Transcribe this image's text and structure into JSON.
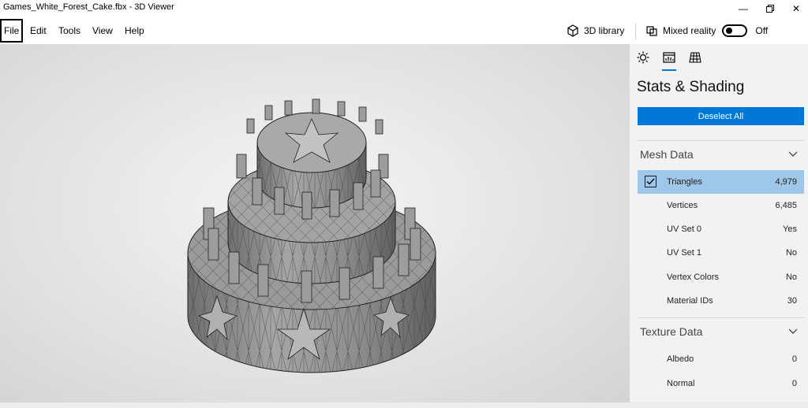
{
  "window": {
    "title": "Games_White_Forest_Cake.fbx - 3D Viewer"
  },
  "menu": [
    "File",
    "Edit",
    "Tools",
    "View",
    "Help"
  ],
  "toolbar": {
    "library_label": "3D library",
    "mixed_reality_label": "Mixed reality",
    "mixed_reality_state": "Off"
  },
  "panel": {
    "tabs": [
      "lighting-tab",
      "stats-shading-tab",
      "grid-tab"
    ],
    "title": "Stats & Shading",
    "deselect_label": "Deselect All",
    "mesh_section": "Mesh Data",
    "mesh_rows": [
      {
        "label": "Triangles",
        "value": "4,979"
      },
      {
        "label": "Vertices",
        "value": "6,485"
      },
      {
        "label": "UV Set 0",
        "value": "Yes"
      },
      {
        "label": "UV Set 1",
        "value": "No"
      },
      {
        "label": "Vertex Colors",
        "value": "No"
      },
      {
        "label": "Material IDs",
        "value": "30"
      }
    ],
    "texture_section": "Texture Data",
    "texture_rows": [
      {
        "label": "Albedo",
        "value": "0"
      },
      {
        "label": "Normal",
        "value": "0"
      }
    ]
  },
  "colors": {
    "accent": "#0078d7",
    "selection": "#9ec7ea",
    "sidebar": "#f2f2f2",
    "model": "#8a8a8a"
  }
}
